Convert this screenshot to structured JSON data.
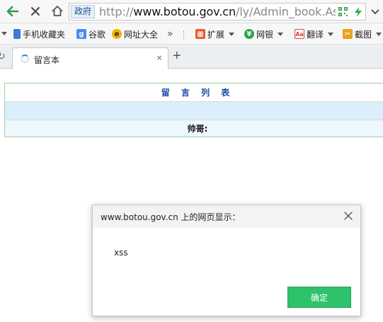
{
  "address_bar": {
    "badge": "政府",
    "url_scheme": "http://",
    "url_domain": "www.botou.gov.cn",
    "url_path": "/ly/Admin_book.Asp",
    "icons": [
      "back-arrow-icon",
      "stop-x-icon",
      "home-icon",
      "qr-code-icon",
      "lightning-icon",
      "chevron-down-icon"
    ]
  },
  "bookmarks": {
    "items": [
      {
        "label": "手机收藏夹",
        "icon": "phone-icon",
        "color": "#3b7bd4"
      },
      {
        "label": "谷歌",
        "icon": "google-g-icon",
        "color": "#4a8af4"
      },
      {
        "label": "网址大全",
        "icon": "url-nav-icon",
        "color": "#f0b400"
      },
      {
        "label": "»",
        "icon": "more-chevron-icon"
      },
      {
        "label": "扩展",
        "icon": "extension-icon",
        "color": "#e65c2c"
      },
      {
        "label": "网银",
        "icon": "bank-shield-icon",
        "color": "#2aa54a"
      },
      {
        "label": "翻译",
        "icon": "translate-icon",
        "color": "#d94141"
      },
      {
        "label": "截图",
        "icon": "screenshot-icon",
        "color": "#e6a21a"
      }
    ]
  },
  "tabs": {
    "active_title": "留言本",
    "close_glyph": "×",
    "new_tab_glyph": "+"
  },
  "page": {
    "table_title": "留 言 列 表",
    "name_row": "帅哥:"
  },
  "dialog": {
    "title": "www.botou.gov.cn 上的网页显示：",
    "message": "xss",
    "ok_label": "确定",
    "ok_color": "#2ec26a"
  }
}
